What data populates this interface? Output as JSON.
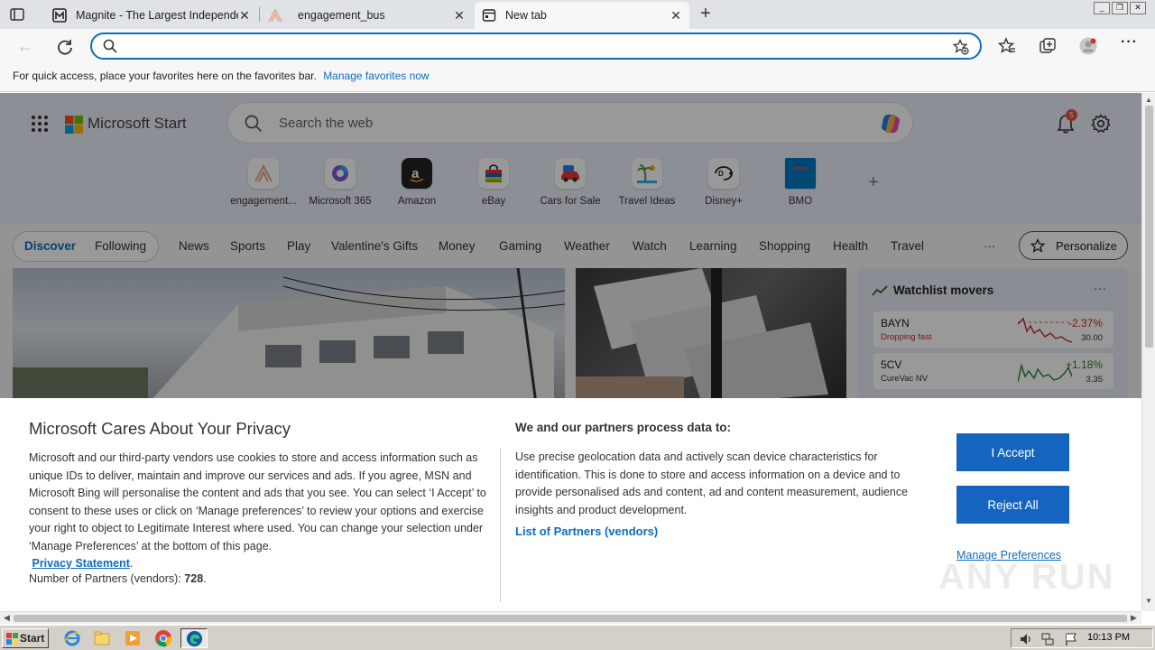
{
  "browser": {
    "tabs": [
      {
        "title": "Magnite - The Largest Independe",
        "icon": "magnite-icon"
      },
      {
        "title": "engagement_bus",
        "icon": "engagement-icon"
      },
      {
        "title": "New tab",
        "icon": "newtab-icon"
      }
    ],
    "address_placeholder": "",
    "favorites_bar_text": "For quick access, place your favorites here on the favorites bar.",
    "favorites_bar_link": "Manage favorites now",
    "accent": "#0f6cbd"
  },
  "msn": {
    "brand": "Microsoft Start",
    "search_placeholder": "Search the web",
    "notification_count": "5",
    "quick_links": [
      {
        "label": "engagement..."
      },
      {
        "label": "Microsoft 365"
      },
      {
        "label": "Amazon"
      },
      {
        "label": "eBay"
      },
      {
        "label": "Cars for Sale"
      },
      {
        "label": "Travel Ideas"
      },
      {
        "label": "Disney+"
      },
      {
        "label": "BMO"
      }
    ],
    "nav": {
      "discover": "Discover",
      "following": "Following",
      "items": [
        "News",
        "Sports",
        "Play",
        "Valentine's Gifts",
        "Money",
        "Gaming",
        "Weather",
        "Watch",
        "Learning",
        "Shopping",
        "Health",
        "Travel"
      ],
      "more": "···",
      "personalize": "Personalize"
    },
    "watchlist": {
      "title": "Watchlist movers",
      "more": "···",
      "stocks": [
        {
          "symbol": "BAYN",
          "subtitle": "Dropping fast",
          "change": "-2.37%",
          "price": "30.00",
          "color": "#c62828"
        },
        {
          "symbol": "5CV",
          "subtitle": "CureVac NV",
          "change": "+1.18%",
          "price": "3.35",
          "color": "#2e7d32"
        }
      ]
    }
  },
  "privacy": {
    "title": "Microsoft Cares About Your Privacy",
    "body": "Microsoft and our third-party vendors use cookies to store and access information such as unique IDs to deliver, maintain and improve our services and ads. If you agree, MSN and Microsoft Bing will personalise the content and ads that you see. You can select ‘I Accept’ to consent to these uses or click on ‘Manage preferences’ to review your options and exercise your right to object to Legitimate Interest where used.  You can change your selection under ‘Manage Preferences’ at the bottom of this page.",
    "statement_link": "Privacy Statement",
    "partners_label": "Number of Partners (vendors):",
    "partners_count": "728",
    "heading2": "We and our partners process data to:",
    "body2": "Use precise geolocation data and actively scan device characteristics for identification. This is done to store and access information on a device and to provide personalised ads and content, ad and content measurement, audience insights and product development.",
    "vendors_link": "List of Partners (vendors)",
    "accept": "I Accept",
    "reject": "Reject All",
    "manage": "Manage Preferences",
    "watermark": "ANY RUN"
  },
  "taskbar": {
    "start": "Start",
    "clock": "10:13 PM"
  }
}
